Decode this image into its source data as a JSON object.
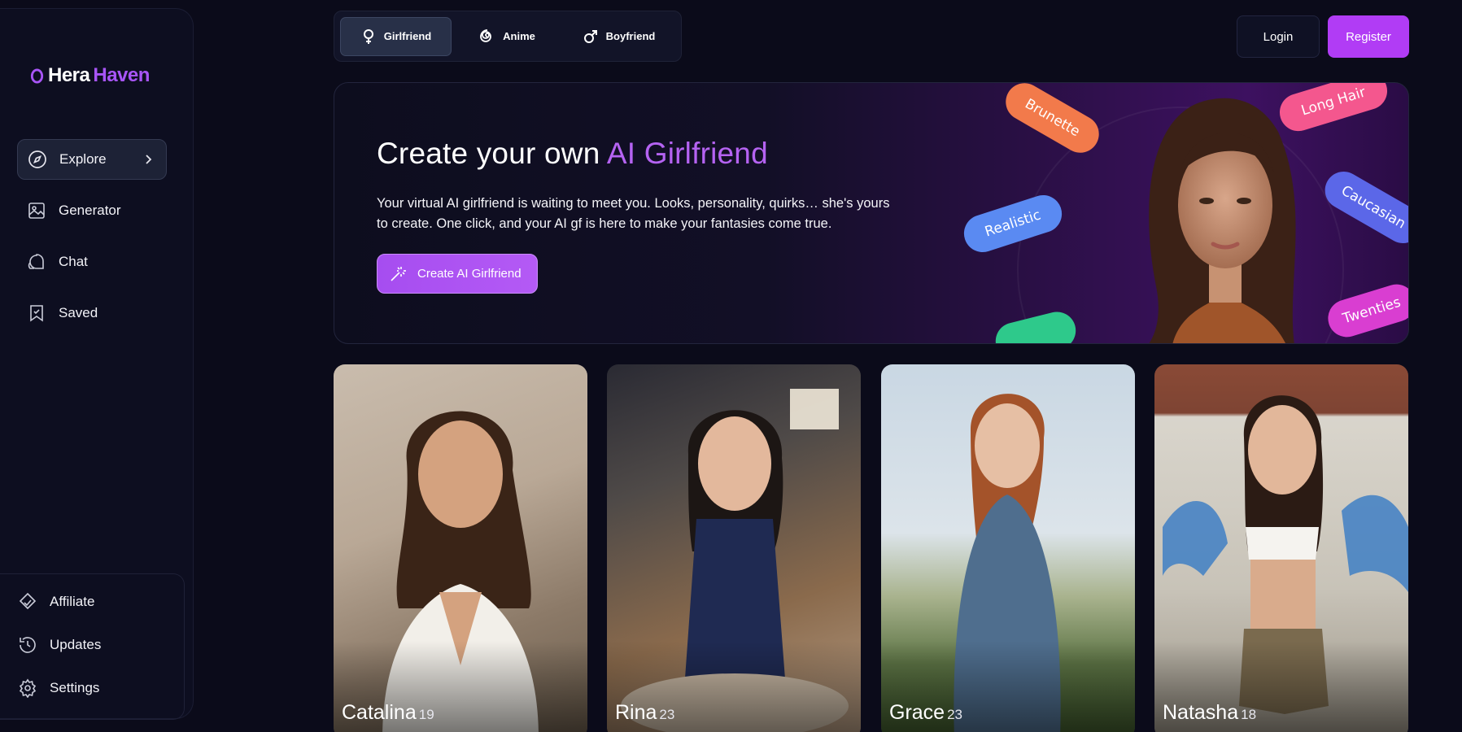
{
  "brand": {
    "name_part1": "Hera",
    "name_part2": "Haven",
    "accent": "#a855f7"
  },
  "sidebar": {
    "items": [
      {
        "label": "Explore",
        "icon": "compass-icon",
        "active": true
      },
      {
        "label": "Generator",
        "icon": "image-icon",
        "active": false
      },
      {
        "label": "Chat",
        "icon": "chat-icon",
        "active": false
      },
      {
        "label": "Saved",
        "icon": "bookmark-icon",
        "active": false
      }
    ],
    "bottom_items": [
      {
        "label": "Affiliate",
        "icon": "affiliate-icon"
      },
      {
        "label": "Updates",
        "icon": "history-icon"
      },
      {
        "label": "Settings",
        "icon": "gear-icon"
      }
    ]
  },
  "tabs": [
    {
      "label": "Girlfriend",
      "icon": "female-icon",
      "active": true
    },
    {
      "label": "Anime",
      "icon": "swirl-icon",
      "active": false
    },
    {
      "label": "Boyfriend",
      "icon": "male-icon",
      "active": false
    }
  ],
  "header": {
    "login_label": "Login",
    "register_label": "Register"
  },
  "hero": {
    "title_plain": "Create your own ",
    "title_highlight": "AI Girlfriend",
    "description": "Your virtual AI girlfriend is waiting to meet you. Looks, personality, quirks… she's yours to create. One click, and your AI gf is here to make your fantasies come true.",
    "cta_label": "Create AI Girlfriend",
    "tags": [
      "Brunette",
      "Realistic",
      "Long Hair",
      "Caucasian",
      "Twenties"
    ]
  },
  "characters": [
    {
      "name": "Catalina",
      "age": "19"
    },
    {
      "name": "Rina",
      "age": "23"
    },
    {
      "name": "Grace",
      "age": "23"
    },
    {
      "name": "Natasha",
      "age": "18"
    }
  ]
}
